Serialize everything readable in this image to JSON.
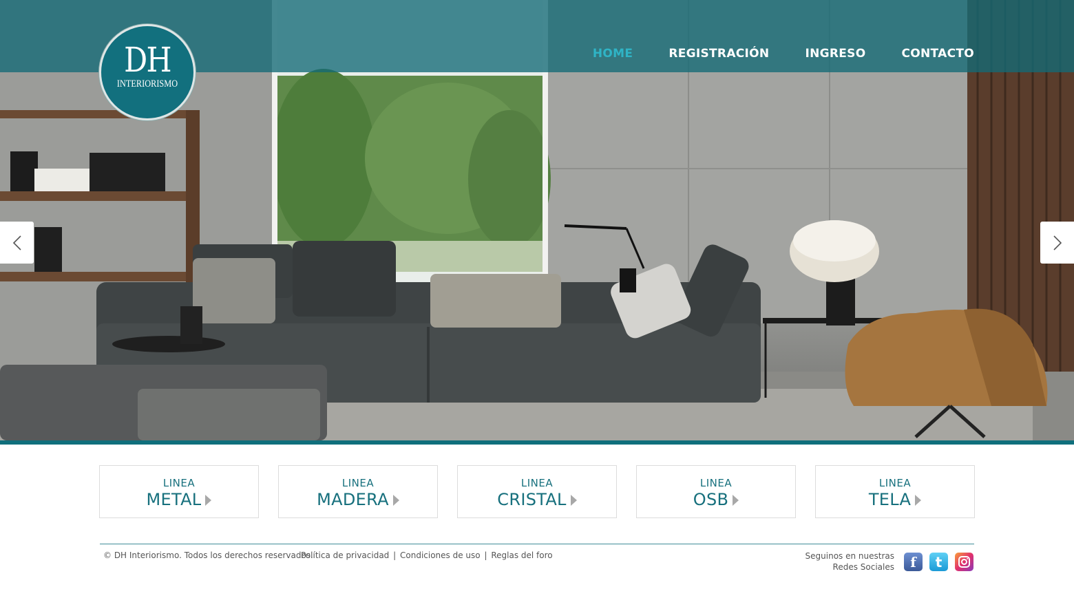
{
  "logo": {
    "title": "DH",
    "subtitle": "INTERIORISMO"
  },
  "nav": {
    "items": [
      {
        "label": "HOME",
        "active": true
      },
      {
        "label": "REGISTRACIÓN",
        "active": false
      },
      {
        "label": "INGRESO",
        "active": false
      },
      {
        "label": "CONTACTO",
        "active": false
      }
    ]
  },
  "slider": {
    "prev_icon": "chevron-left-icon",
    "next_icon": "chevron-right-icon"
  },
  "lines": [
    {
      "kicker": "LINEA",
      "name": "METAL"
    },
    {
      "kicker": "LINEA",
      "name": "MADERA"
    },
    {
      "kicker": "LINEA",
      "name": "CRISTAL"
    },
    {
      "kicker": "LINEA",
      "name": "OSB"
    },
    {
      "kicker": "LINEA",
      "name": "TELA"
    }
  ],
  "footer": {
    "copyright": "© DH Interiorismo. Todos los derechos reservados.",
    "links": [
      "Política de privacidad",
      "Condiciones de uso",
      "Reglas del foro"
    ],
    "separator": "|",
    "social_line1": "Seguinos en nuestras",
    "social_line2": "Redes Sociales",
    "social": [
      {
        "name": "facebook-icon",
        "glyph": "f"
      },
      {
        "name": "twitter-icon",
        "glyph": "t"
      },
      {
        "name": "instagram-icon",
        "glyph": ""
      }
    ]
  },
  "colors": {
    "brand": "#106f7c",
    "nav_active": "#2fb4c6",
    "line_text": "#17707d"
  }
}
